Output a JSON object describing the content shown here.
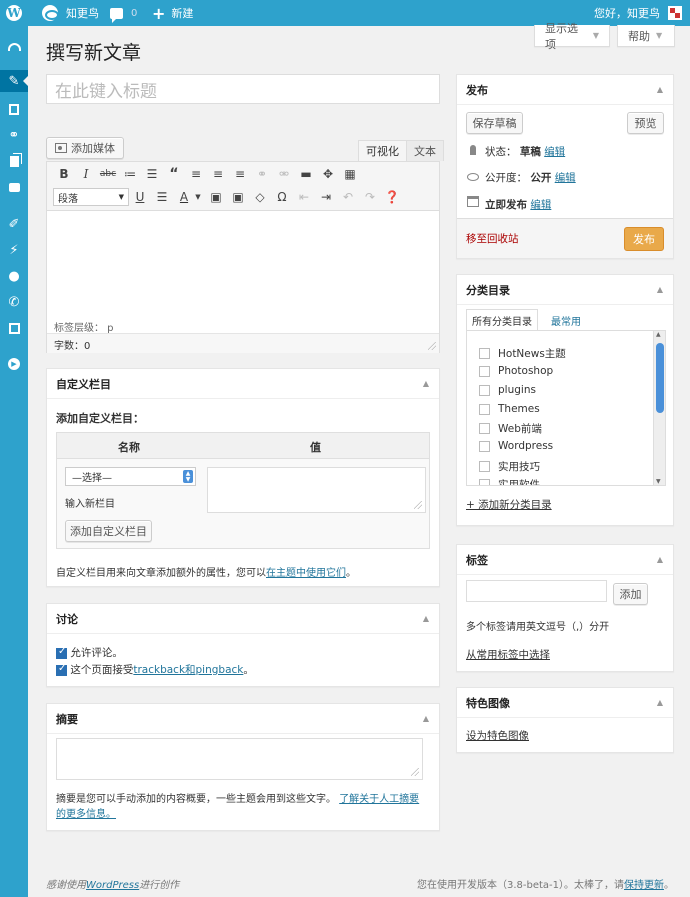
{
  "adminbar": {
    "site_name": "知更鸟",
    "comment_count": "0",
    "new_label": "新建",
    "greeting": "您好，知更鸟"
  },
  "screen_meta": {
    "screen_options": "显示选项",
    "help": "帮助"
  },
  "page": {
    "title": "撰写新文章",
    "title_placeholder": "在此键入标题"
  },
  "editor": {
    "add_media": "添加媒体",
    "tab_visual": "可视化",
    "tab_text": "文本",
    "format_value": "段落",
    "status_path": "标签层级： p",
    "word_count": "字数：0"
  },
  "custom_fields": {
    "title": "自定义栏目",
    "add_label": "添加自定义栏目：",
    "col_name": "名称",
    "col_value": "值",
    "select_value": "—选择—",
    "enter_new": "输入新栏目",
    "add_button": "添加自定义栏目",
    "help_text": "自定义栏目用来向文章添加额外的属性，您可以",
    "help_link": "在主题中使用它们",
    "help_end": "。"
  },
  "discussion": {
    "title": "讨论",
    "allow_comments": "允许评论。",
    "allow_trackbacks_prefix": "这个页面接受",
    "allow_trackbacks_link": "trackback和pingback",
    "allow_trackbacks_suffix": "。"
  },
  "excerpt": {
    "title": "摘要",
    "help_text": "摘要是您可以手动添加的内容概要，一些主题会用到这些文字。",
    "help_link_1": "了解关于人工摘要",
    "help_link_2": "的更多信息。"
  },
  "publish": {
    "title": "发布",
    "save_draft": "保存草稿",
    "preview": "预览",
    "status_label": "状态：",
    "status_value": "草稿",
    "visibility_label": "公开度：",
    "visibility_value": "公开",
    "publish_time": "立即发布",
    "edit": "编辑",
    "trash": "移至回收站",
    "publish_button": "发布"
  },
  "categories": {
    "title": "分类目录",
    "tab_all": "所有分类目录",
    "tab_popular": "最常用",
    "items": [
      {
        "label": "HotNews主题"
      },
      {
        "label": "Photoshop"
      },
      {
        "label": "plugins"
      },
      {
        "label": "Themes"
      },
      {
        "label": "Web前端"
      },
      {
        "label": "Wordpress"
      },
      {
        "label": "实用技巧"
      },
      {
        "label": "实用软件"
      }
    ],
    "add_new": "+ 添加新分类目录"
  },
  "tags": {
    "title": "标签",
    "add_button": "添加",
    "hint": "多个标签请用英文逗号（,）分开",
    "choose_link": "从常用标签中选择"
  },
  "featured_image": {
    "title": "特色图像",
    "set_link": "设为特色图像"
  },
  "footer": {
    "thanks_prefix": "感谢使用",
    "thanks_link": "WordPress",
    "thanks_suffix": "进行创作",
    "version_text": "您在使用开发版本（3.8-beta-1）。太棒了，请",
    "version_link": "保持更新",
    "version_end": "。"
  },
  "colors": {
    "adminbar": "#2ea2cc",
    "menu_current": "#0074a2",
    "link": "#21759b",
    "publish_button": "#e9a94a",
    "trash": "#a00"
  }
}
